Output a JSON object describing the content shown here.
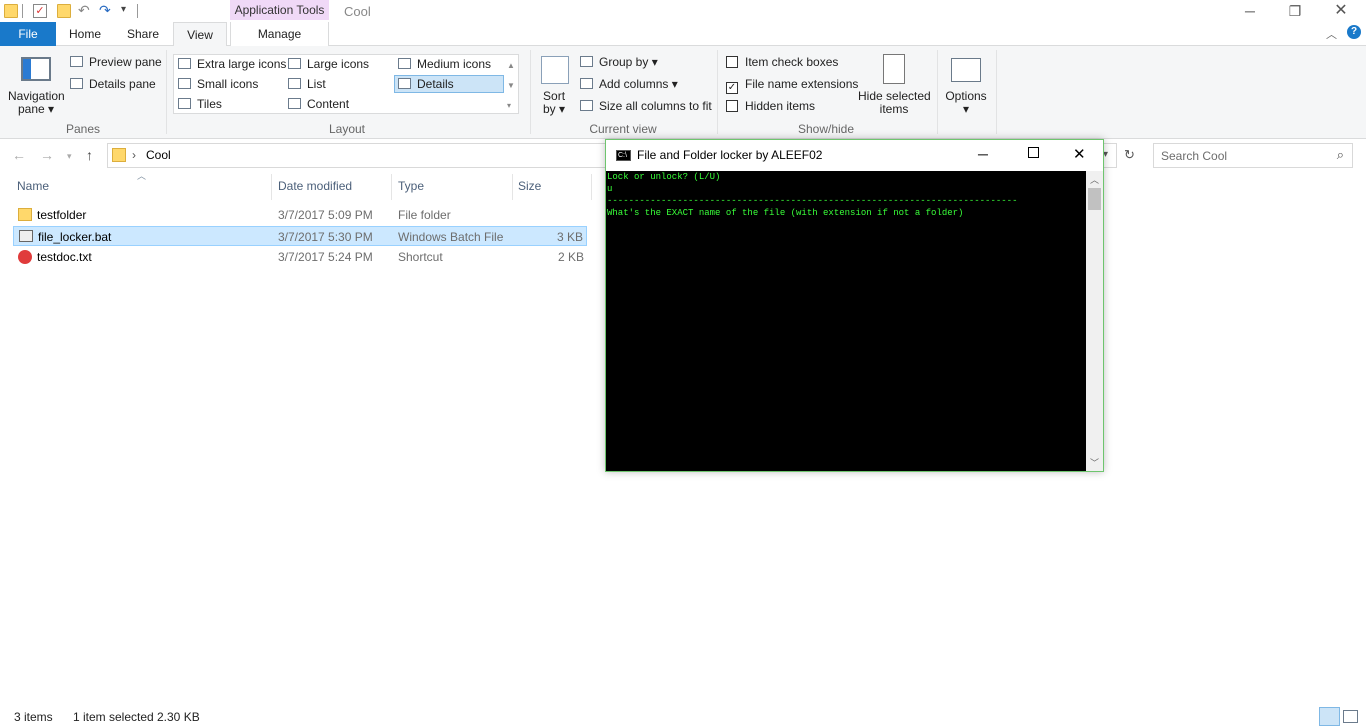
{
  "titlebar": {
    "context_tab": "Application Tools",
    "window_title": "Cool"
  },
  "tabs": {
    "file": "File",
    "home": "Home",
    "share": "Share",
    "view": "View",
    "manage": "Manage"
  },
  "ribbon": {
    "panes": {
      "navigation_pane": "Navigation",
      "navigation_pane2": "pane",
      "preview_pane": "Preview pane",
      "details_pane": "Details pane",
      "group": "Panes"
    },
    "layout": {
      "extra_large": "Extra large icons",
      "large": "Large icons",
      "medium": "Medium icons",
      "small": "Small icons",
      "list": "List",
      "details": "Details",
      "tiles": "Tiles",
      "content": "Content",
      "group": "Layout"
    },
    "current_view": {
      "sort_by": "Sort",
      "sort_by2": "by",
      "group_by": "Group by",
      "add_columns": "Add columns",
      "size_all": "Size all columns to fit",
      "group": "Current view"
    },
    "show_hide": {
      "item_check_boxes": "Item check boxes",
      "file_name_ext": "File name extensions",
      "hidden_items": "Hidden items",
      "hide_selected": "Hide selected",
      "hide_selected2": "items",
      "group": "Show/hide",
      "file_name_ext_checked": true
    },
    "options": "Options"
  },
  "address": {
    "path": "Cool",
    "search_placeholder": "Search Cool"
  },
  "columns": {
    "name": "Name",
    "date": "Date modified",
    "type": "Type",
    "size": "Size"
  },
  "files": [
    {
      "name": "testfolder",
      "date": "3/7/2017 5:09 PM",
      "type": "File folder",
      "size": ""
    },
    {
      "name": "file_locker.bat",
      "date": "3/7/2017 5:30 PM",
      "type": "Windows Batch File",
      "size": "3 KB"
    },
    {
      "name": "testdoc.txt",
      "date": "3/7/2017 5:24 PM",
      "type": "Shortcut",
      "size": "2 KB"
    }
  ],
  "console": {
    "title": "File and Folder locker by ALEEF02",
    "lines": [
      "Lock or unlock? (L/U)",
      "u",
      "----------------------------------------------------------------------------",
      "What's the EXACT name of the file (with extension if not a folder)"
    ]
  },
  "status": {
    "count": "3 items",
    "selected": "1 item selected",
    "size": "2.30 KB"
  },
  "colors": {
    "file_tab": "#1979ca",
    "selection": "#cce8ff",
    "console_text": "#39ff39",
    "context_tab": "#f0d9f7"
  }
}
